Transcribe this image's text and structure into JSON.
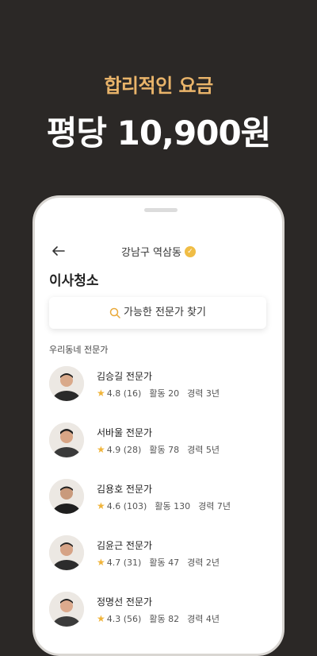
{
  "hero": {
    "subtitle": "합리적인 요금",
    "title": "평당 10,900원"
  },
  "header": {
    "location": "강남구 역삼동"
  },
  "page": {
    "title": "이사청소"
  },
  "search": {
    "label": "가능한 전문가 찾기"
  },
  "section": {
    "label": "우리동네 전문가"
  },
  "experts": [
    {
      "name": "김승길 전문가",
      "rating": "4.8",
      "reviews": "(16)",
      "activity": "활동 20",
      "career": "경력 3년"
    },
    {
      "name": "서바울 전문가",
      "rating": "4.9",
      "reviews": "(28)",
      "activity": "활동 78",
      "career": "경력 5년"
    },
    {
      "name": "김용호 전문가",
      "rating": "4.6",
      "reviews": "(103)",
      "activity": "활동 130",
      "career": "경력 7년"
    },
    {
      "name": "김윤근 전문가",
      "rating": "4.7",
      "reviews": "(31)",
      "activity": "활동 47",
      "career": "경력 2년"
    },
    {
      "name": "정명선 전문가",
      "rating": "4.3",
      "reviews": "(56)",
      "activity": "활동 82",
      "career": "경력 4년"
    }
  ],
  "colors": {
    "background": "#2b2826",
    "accent": "#e9b46a",
    "star": "#f0b43a",
    "verified": "#f0bd45"
  }
}
